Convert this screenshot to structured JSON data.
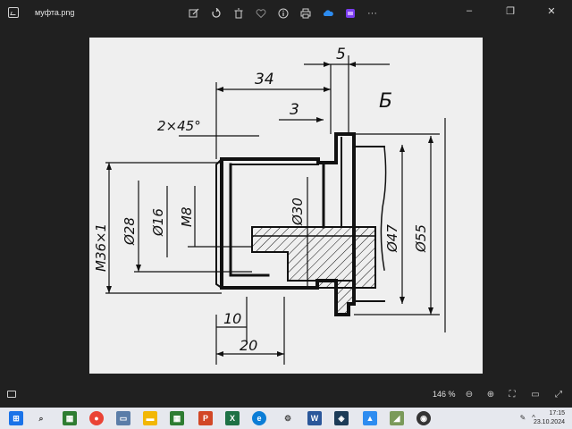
{
  "window": {
    "filename": "муфта.png",
    "controls": {
      "minimize": "–",
      "maximize": "❐",
      "close": "✕"
    }
  },
  "toolbar": {
    "items": [
      "edit-icon",
      "rotate-icon",
      "delete-icon",
      "favorite-icon",
      "info-icon",
      "print-icon",
      "onedrive-icon",
      "clipchamp-icon",
      "more-icon"
    ],
    "more_label": "···"
  },
  "drawing": {
    "dimensions": {
      "d34": "34",
      "d5": "5",
      "d3": "3",
      "chamfer": "2×45°",
      "b": "Б",
      "m36": "M36×1",
      "d28": "Ø28",
      "d16": "Ø16",
      "m8": "M8",
      "d30": "Ø30",
      "d47": "Ø47",
      "d55": "Ø55",
      "d10": "10",
      "d20": "20"
    }
  },
  "statusbar": {
    "zoom": "146 %"
  },
  "taskbar": {
    "time": "17:15",
    "date": "23.10.2024"
  }
}
